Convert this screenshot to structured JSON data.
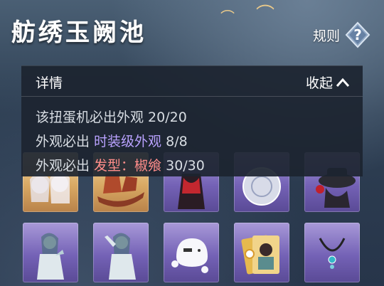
{
  "header": {
    "title": "舫绣玉阙池",
    "rules_label": "规则"
  },
  "details": {
    "title": "详情",
    "collapse_label": "收起",
    "lines": [
      {
        "text": "该扭蛋机必出外观 20/20"
      },
      {
        "prefix": "外观必出 ",
        "highlight": "时装级外观",
        "suffix": " 8/8"
      },
      {
        "prefix": "外观必出 ",
        "highlight": "发型：椒飨",
        "suffix": " 30/30"
      }
    ]
  },
  "items": [
    {
      "rarity": "gold",
      "icon": "two-ladies-portrait-icon"
    },
    {
      "rarity": "gold",
      "icon": "dragon-boat-icon"
    },
    {
      "rarity": "purple",
      "icon": "red-dress-outfit-icon"
    },
    {
      "rarity": "purple",
      "icon": "silver-disc-icon"
    },
    {
      "rarity": "purple",
      "icon": "black-hat-rose-icon"
    },
    {
      "rarity": "purple",
      "icon": "lady-thinking-pose-icon"
    },
    {
      "rarity": "purple",
      "icon": "lady-salute-pose-icon"
    },
    {
      "rarity": "purple",
      "icon": "ghost-sticker-icon"
    },
    {
      "rarity": "purple",
      "icon": "photo-card-icon"
    },
    {
      "rarity": "purple",
      "icon": "pendant-necklace-icon"
    }
  ]
}
